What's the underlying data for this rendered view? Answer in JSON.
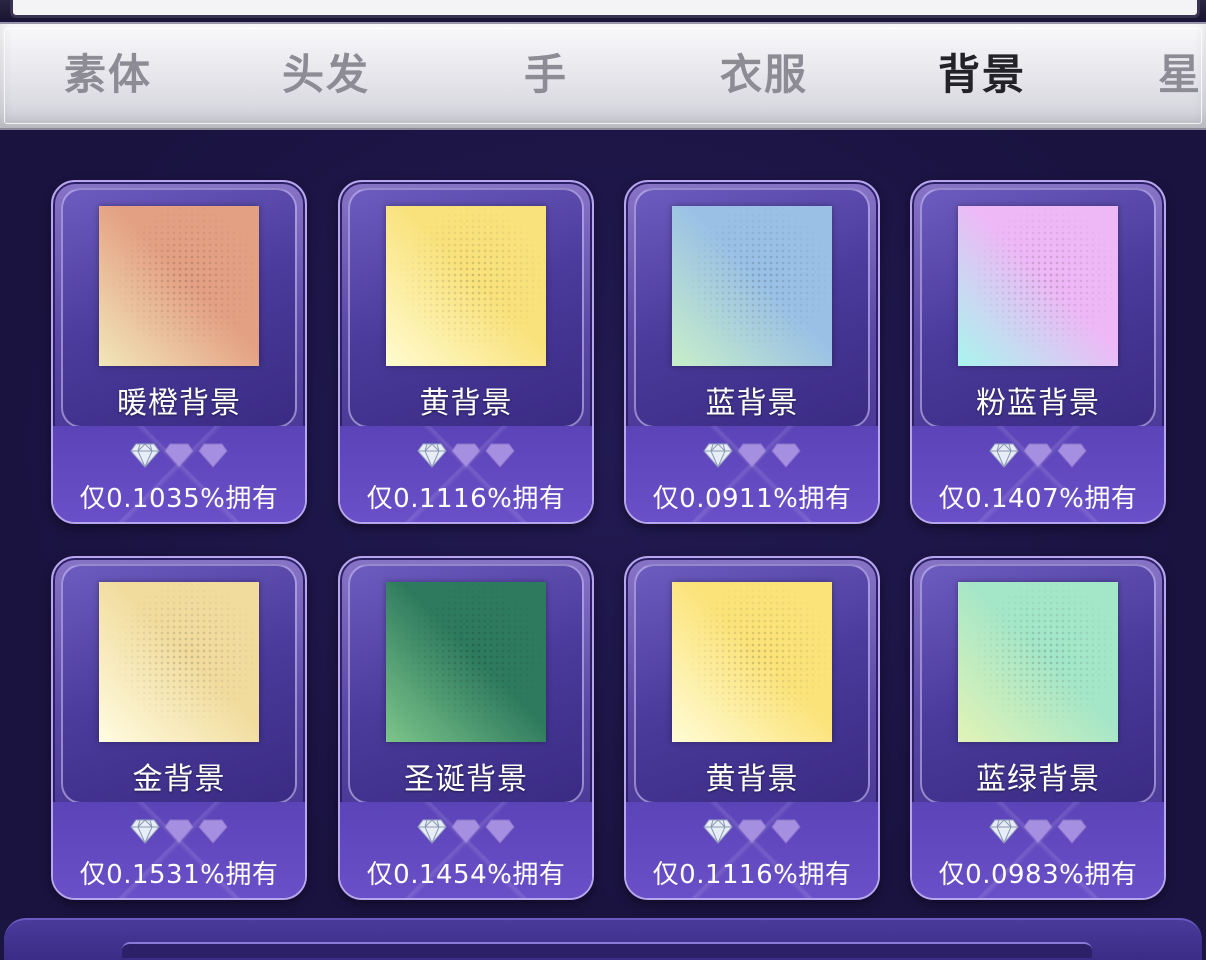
{
  "tabs": [
    {
      "label": "素体",
      "active": false
    },
    {
      "label": "头发",
      "active": false
    },
    {
      "label": "手",
      "active": false
    },
    {
      "label": "衣服",
      "active": false
    },
    {
      "label": "背景",
      "active": true
    },
    {
      "label": "星",
      "active": false
    }
  ],
  "items": [
    {
      "name": "暖橙背景",
      "own": "仅0.1035%拥有",
      "gems_lit": 1,
      "colors": [
        "#e4a083",
        "#f1e7b8"
      ]
    },
    {
      "name": "黄背景",
      "own": "仅0.1116%拥有",
      "gems_lit": 1,
      "colors": [
        "#f9e27c",
        "#fffbd0"
      ]
    },
    {
      "name": "蓝背景",
      "own": "仅0.0911%拥有",
      "gems_lit": 1,
      "colors": [
        "#9ac0e6",
        "#c7efc8"
      ]
    },
    {
      "name": "粉蓝背景",
      "own": "仅0.1407%拥有",
      "gems_lit": 1,
      "colors": [
        "#eeb8f6",
        "#a9f5ee"
      ]
    },
    {
      "name": "金背景",
      "own": "仅0.1531%拥有",
      "gems_lit": 1,
      "colors": [
        "#f1dc9e",
        "#fffce0"
      ]
    },
    {
      "name": "圣诞背景",
      "own": "仅0.1454%拥有",
      "gems_lit": 1,
      "colors": [
        "#2e7a5e",
        "#7cc58a"
      ]
    },
    {
      "name": "黄背景",
      "own": "仅0.1116%拥有",
      "gems_lit": 1,
      "colors": [
        "#fbe37a",
        "#fffcd6"
      ]
    },
    {
      "name": "蓝绿背景",
      "own": "仅0.0983%拥有",
      "gems_lit": 1,
      "colors": [
        "#a4e6c8",
        "#e2f3b6"
      ]
    }
  ],
  "colors": {
    "gem_lit": "#e8eef8",
    "gem_dim": "#a58fe0"
  }
}
